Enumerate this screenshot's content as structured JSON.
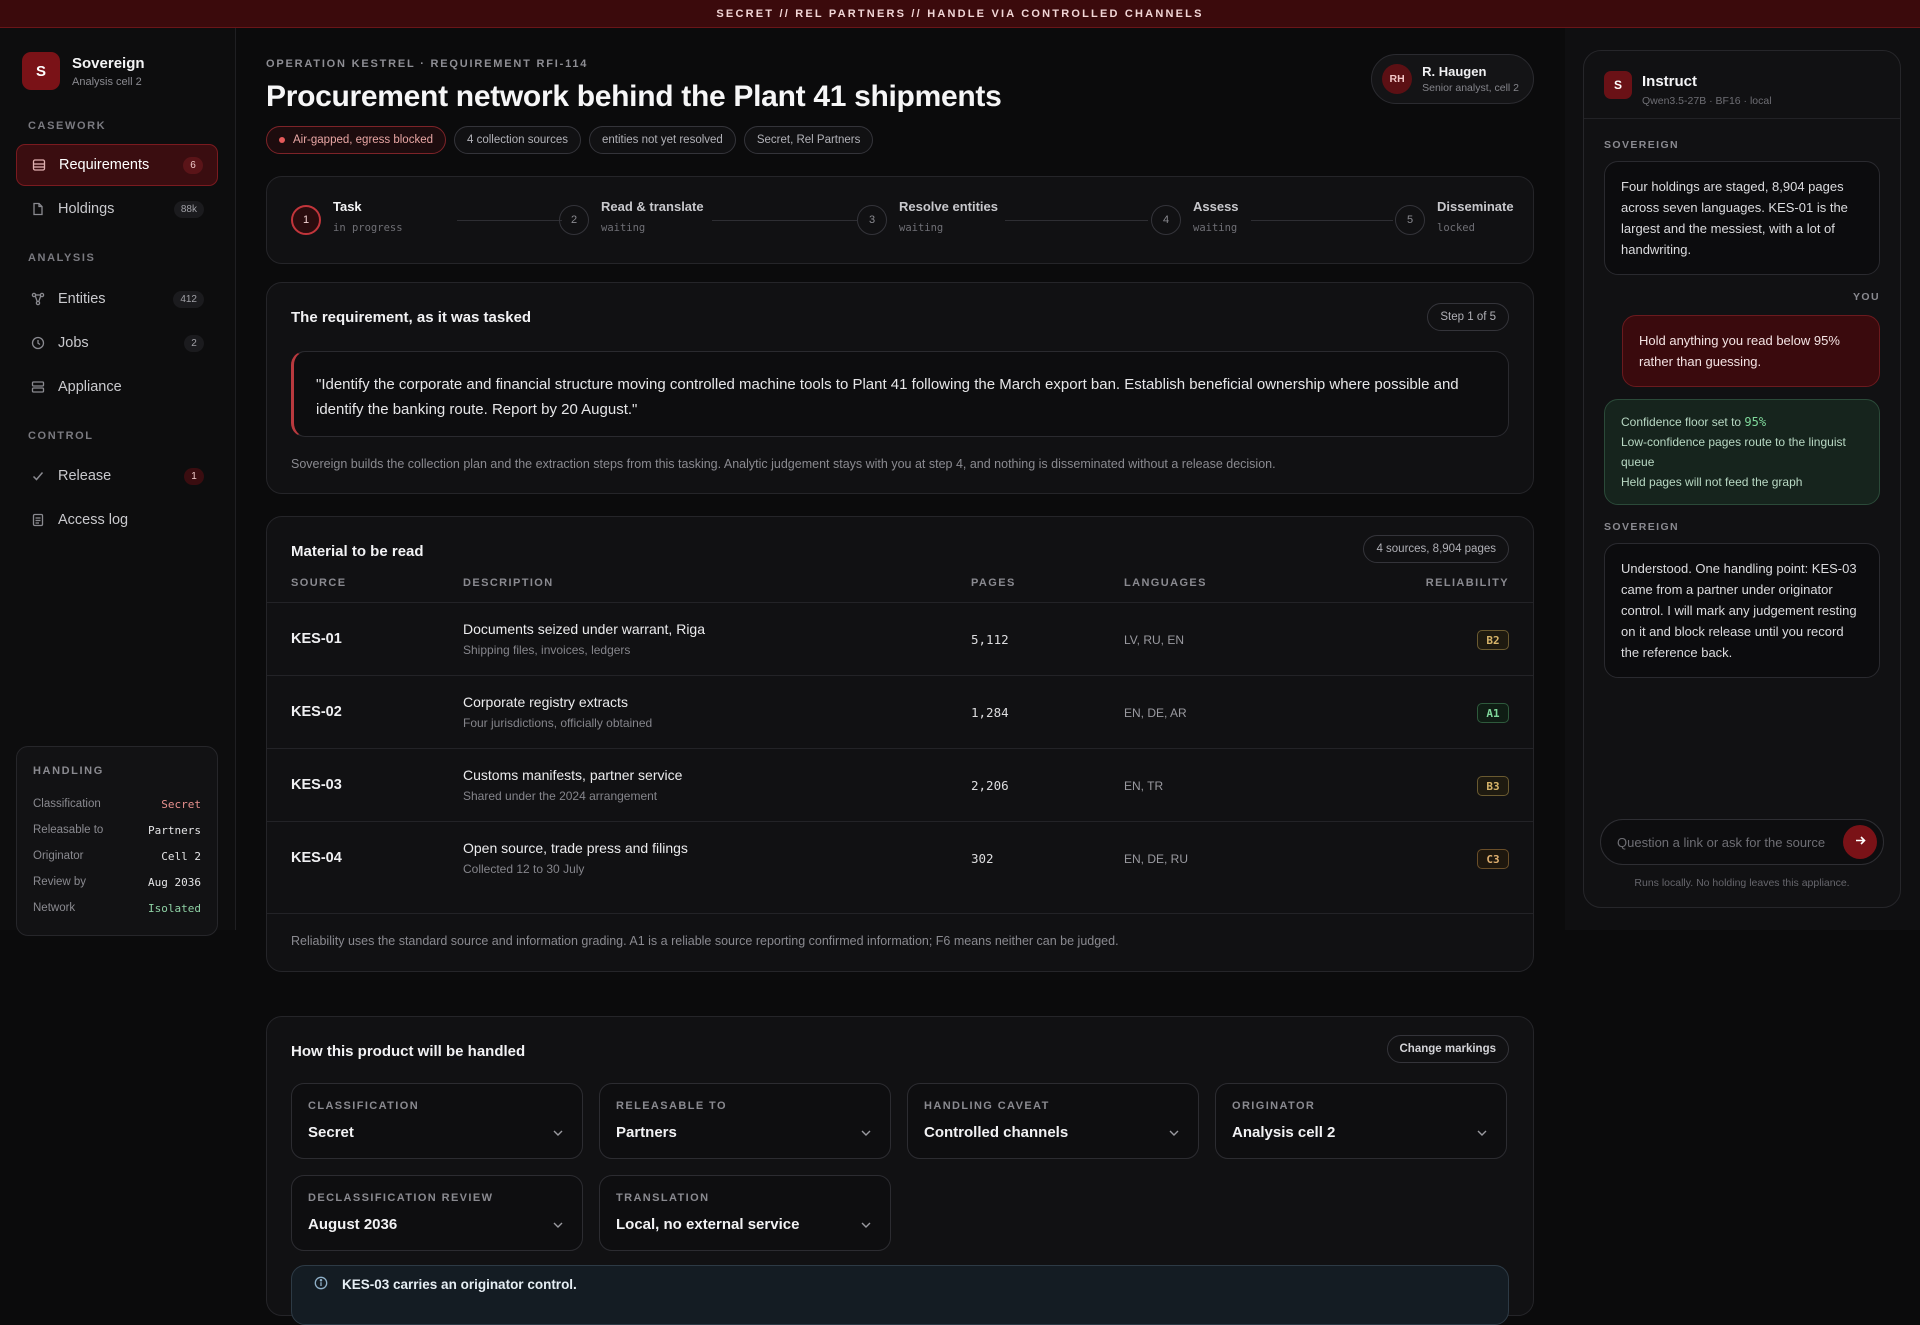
{
  "banner": "SECRET // REL PARTNERS // HANDLE VIA CONTROLLED CHANNELS",
  "brand": {
    "mark": "S",
    "name": "Sovereign",
    "sub": "Analysis cell 2"
  },
  "nav": {
    "casework_label": "CASEWORK",
    "analysis_label": "ANALYSIS",
    "control_label": "CONTROL",
    "requirements": {
      "label": "Requirements",
      "count": "6"
    },
    "holdings": {
      "label": "Holdings",
      "count": "88k"
    },
    "entities": {
      "label": "Entities",
      "count": "412"
    },
    "jobs": {
      "label": "Jobs",
      "count": "2"
    },
    "appliance": {
      "label": "Appliance"
    },
    "release": {
      "label": "Release",
      "count": "1"
    },
    "access_log": {
      "label": "Access log"
    }
  },
  "handling_box": {
    "title": "HANDLING",
    "rows": [
      {
        "k": "Classification",
        "v": "Secret"
      },
      {
        "k": "Releasable to",
        "v": "Partners"
      },
      {
        "k": "Originator",
        "v": "Cell 2"
      },
      {
        "k": "Review by",
        "v": "Aug 2036"
      },
      {
        "k": "Network",
        "v": "Isolated"
      }
    ]
  },
  "header": {
    "eyebrow": "OPERATION KESTREL · REQUIREMENT RFI-114",
    "title": "Procurement network behind the Plant 41 shipments",
    "chips": [
      "Air-gapped, egress blocked",
      "4 collection sources",
      "entities not yet resolved",
      "Secret, Rel Partners"
    ],
    "user": {
      "initials": "RH",
      "name": "R. Haugen",
      "role": "Senior analyst, cell 2"
    }
  },
  "steps": [
    {
      "num": "1",
      "label": "Task",
      "status": "in progress"
    },
    {
      "num": "2",
      "label": "Read & translate",
      "status": "waiting"
    },
    {
      "num": "3",
      "label": "Resolve entities",
      "status": "waiting"
    },
    {
      "num": "4",
      "label": "Assess",
      "status": "waiting"
    },
    {
      "num": "5",
      "label": "Disseminate",
      "status": "locked"
    }
  ],
  "requirement": {
    "heading": "The requirement, as it was tasked",
    "step_pill": "Step 1 of 5",
    "quote": "\"Identify the corporate and financial structure moving controlled machine tools to Plant 41 following the March export ban. Establish beneficial ownership where possible and identify the banking route. Report by 20 August.\"",
    "note": "Sovereign builds the collection plan and the extraction steps from this tasking. Analytic judgement stays with you at step 4, and nothing is disseminated without a release decision."
  },
  "material": {
    "heading": "Material to be read",
    "pill": "4 sources, 8,904 pages",
    "columns": [
      "SOURCE",
      "DESCRIPTION",
      "PAGES",
      "LANGUAGES",
      "RELIABILITY"
    ],
    "rows": [
      {
        "source": "KES-01",
        "desc": "Documents seized under warrant, Riga",
        "sub": "Shipping files, invoices, ledgers",
        "pages": "5,112",
        "langs": "LV, RU, EN",
        "grade": "B2"
      },
      {
        "source": "KES-02",
        "desc": "Corporate registry extracts",
        "sub": "Four jurisdictions, officially obtained",
        "pages": "1,284",
        "langs": "EN, DE, AR",
        "grade": "A1"
      },
      {
        "source": "KES-03",
        "desc": "Customs manifests, partner service",
        "sub": "Shared under the 2024 arrangement",
        "pages": "2,206",
        "langs": "EN, TR",
        "grade": "B3"
      },
      {
        "source": "KES-04",
        "desc": "Open source, trade press and filings",
        "sub": "Collected 12 to 30 July",
        "pages": "302",
        "langs": "EN, DE, RU",
        "grade": "C3"
      }
    ],
    "note": "Reliability uses the standard source and information grading. A1 is a reliable source reporting confirmed information; F6 means neither can be judged."
  },
  "handled": {
    "heading": "How this product will be handled",
    "change_button": "Change markings",
    "fields": [
      {
        "label": "CLASSIFICATION",
        "value": "Secret"
      },
      {
        "label": "RELEASABLE TO",
        "value": "Partners"
      },
      {
        "label": "HANDLING CAVEAT",
        "value": "Controlled channels"
      },
      {
        "label": "ORIGINATOR",
        "value": "Analysis cell 2"
      },
      {
        "label": "DECLASSIFICATION REVIEW",
        "value": "August 2036"
      },
      {
        "label": "TRANSLATION",
        "value": "Local, no external service"
      }
    ],
    "warning": "KES-03 carries an originator control."
  },
  "assistant": {
    "mark": "S",
    "title": "Instruct",
    "sub": "Qwen3.5-27B · BF16 · local",
    "messages": [
      {
        "who": "SOVEREIGN",
        "text": "Four holdings are staged, 8,904 pages across seven languages. KES-01 is the largest and the messiest, with a lot of handwriting."
      },
      {
        "who": "YOU",
        "text": "Hold anything you read below 95% rather than guessing."
      },
      {
        "confirm": [
          "Confidence floor set to ",
          "95%",
          "Low-confidence pages route to the linguist queue",
          "Held pages will not feed the graph"
        ]
      },
      {
        "who": "SOVEREIGN",
        "text": "Understood. One handling point: KES-03 came from a partner under originator control. I will mark any judgement resting on it and block release until you record the reference back."
      }
    ],
    "input_placeholder": "Question a link or ask for the source",
    "footer": "Runs locally. No holding leaves this appliance."
  },
  "colors": {
    "accent": "#7a1217",
    "banner": "#3b0a0c",
    "grade_b": "#d8b56a",
    "grade_a": "#7fd89b",
    "grade_c": "#d8b56a"
  }
}
